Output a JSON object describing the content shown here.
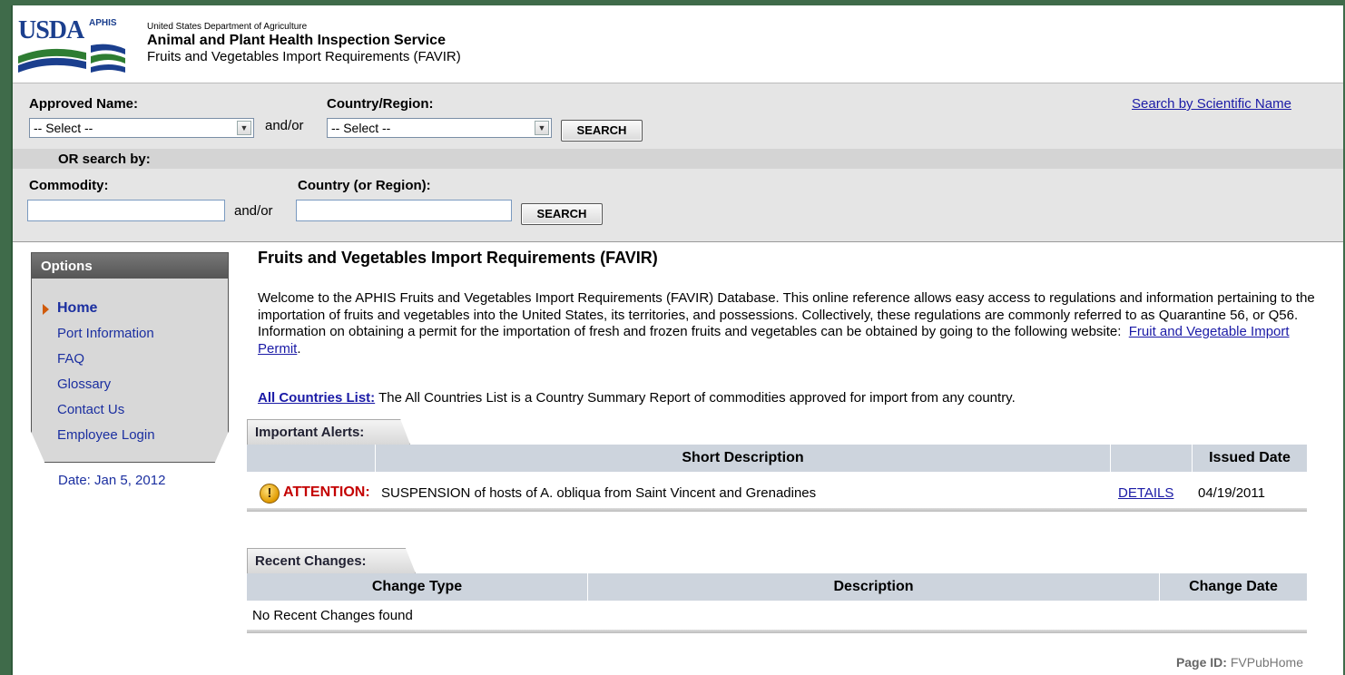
{
  "header": {
    "logo_usda": "USDA",
    "logo_aphis": "APHIS",
    "department": "United States Department of Agriculture",
    "agency": "Animal and Plant Health Inspection Service",
    "app_name": "Fruits and Vegetables Import Requirements (FAVIR)"
  },
  "search": {
    "approved_name_label": "Approved Name:",
    "approved_name_value": "-- Select --",
    "andor_1": "and/or",
    "country_region_label": "Country/Region:",
    "country_region_value": "-- Select --",
    "search_button_1": "SEARCH",
    "scientific_link": "Search by Scientific Name",
    "or_search_by": "OR search by:",
    "commodity_label": "Commodity:",
    "commodity_value": "",
    "andor_2": "and/or",
    "country_or_region_label": "Country (or Region):",
    "country_or_region_value": "",
    "search_button_2": "SEARCH"
  },
  "options": {
    "title": "Options",
    "items": [
      "Home",
      "Port Information",
      "FAQ",
      "Glossary",
      "Contact Us",
      "Employee Login"
    ],
    "active": "Home",
    "date": "Date: Jan 5, 2012"
  },
  "main": {
    "title": "Fruits and Vegetables Import Requirements (FAVIR)",
    "welcome": "Welcome to the APHIS Fruits and Vegetables Import Requirements (FAVIR) Database. This online reference allows easy access to regulations and information pertaining to the importation of fruits and vegetables into the United States, its territories, and possessions. Collectively, these regulations are commonly referred to as Quarantine 56, or Q56. Information on obtaining a permit for the importation of fresh and frozen fruits and vegetables can be obtained by going to the following website:",
    "permit_link": "Fruit and Vegetable Import Permit",
    "all_countries_link": "All Countries List:",
    "all_countries_text": "The All Countries List is a Country Summary Report of commodities approved for import from any country."
  },
  "alerts": {
    "tab": "Important Alerts:",
    "col_short_description": "Short Description",
    "col_issued_date": "Issued Date",
    "rows": [
      {
        "label": "ATTENTION:",
        "text": "SUSPENSION of hosts of A. obliqua from Saint Vincent and Grenadines",
        "link": "DETAILS",
        "date": "04/19/2011"
      }
    ]
  },
  "recent": {
    "tab": "Recent Changes:",
    "col_change_type": "Change Type",
    "col_description": "Description",
    "col_change_date": "Change Date",
    "empty": "No Recent Changes found"
  },
  "footer": {
    "page_id_label": "Page ID:",
    "page_id_value": "FVPubHome"
  }
}
